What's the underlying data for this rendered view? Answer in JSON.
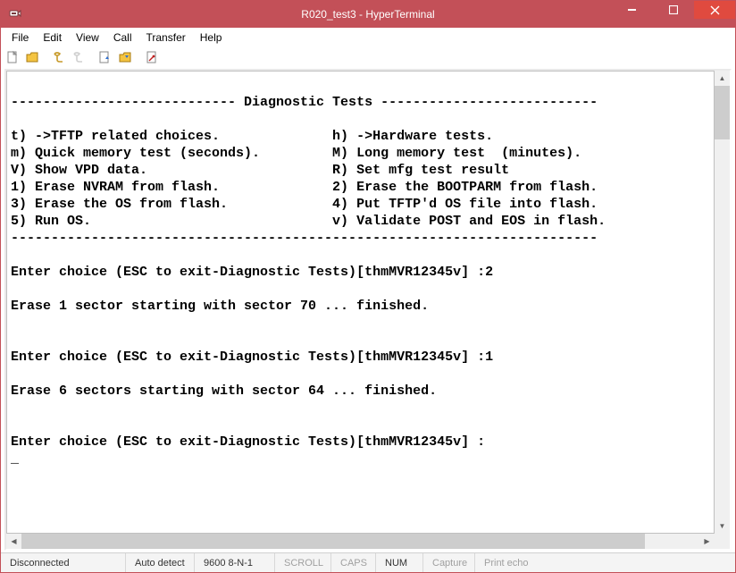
{
  "window": {
    "title": "R020_test3 - HyperTerminal"
  },
  "menubar": {
    "items": [
      "File",
      "Edit",
      "View",
      "Call",
      "Transfer",
      "Help"
    ]
  },
  "toolbar": {
    "buttons": [
      {
        "name": "new-icon"
      },
      {
        "name": "open-icon"
      },
      {
        "name": "call-icon"
      },
      {
        "name": "disconnect-icon"
      },
      {
        "sep": true
      },
      {
        "name": "send-icon"
      },
      {
        "name": "receive-icon"
      },
      {
        "sep": true
      },
      {
        "name": "properties-icon"
      }
    ]
  },
  "terminal": {
    "heading_line": "---------------------------- Diagnostic Tests ---------------------------",
    "menu_left": [
      "t) ->TFTP related choices.",
      "m) Quick memory test (seconds).",
      "V) Show VPD data.",
      "1) Erase NVRAM from flash.",
      "3) Erase the OS from flash.",
      "5) Run OS."
    ],
    "menu_right": [
      "h) ->Hardware tests.",
      "M) Long memory test  (minutes).",
      "R) Set mfg test result",
      "2) Erase the BOOTPARM from flash.",
      "4) Put TFTP'd OS file into flash.",
      "v) Validate POST and EOS in flash."
    ],
    "divider": "-------------------------------------------------------------------------",
    "prompts": [
      "Enter choice (ESC to exit-Diagnostic Tests)[thmMVR12345v] :2",
      "Erase 1 sector starting with sector 70 ... finished.",
      "Enter choice (ESC to exit-Diagnostic Tests)[thmMVR12345v] :1",
      "Erase 6 sectors starting with sector 64 ... finished.",
      "Enter choice (ESC to exit-Diagnostic Tests)[thmMVR12345v] :"
    ],
    "cursor": "_"
  },
  "statusbar": {
    "connection": "Disconnected",
    "detect": "Auto detect",
    "params": "9600 8-N-1",
    "scroll": "SCROLL",
    "caps": "CAPS",
    "num": "NUM",
    "capture": "Capture",
    "echo": "Print echo"
  }
}
